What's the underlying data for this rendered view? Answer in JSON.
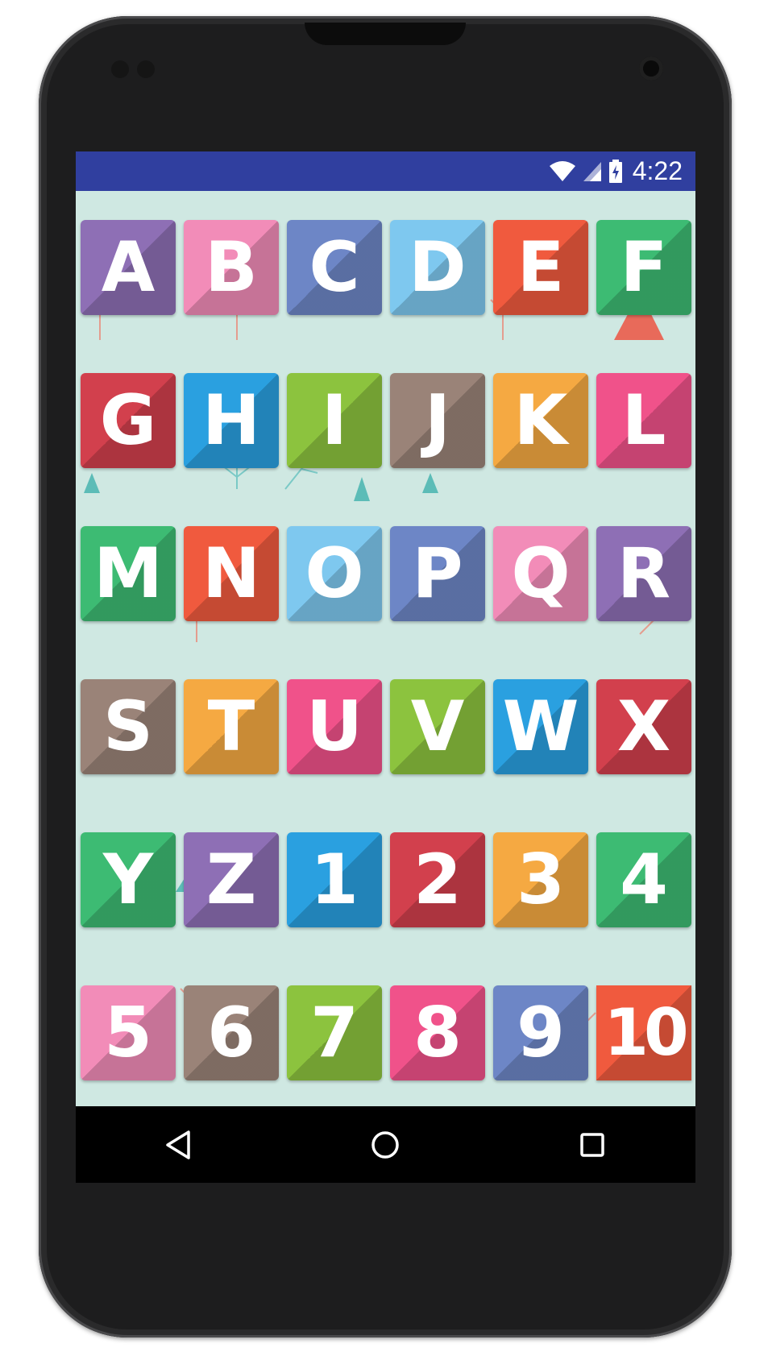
{
  "status_bar": {
    "time": "4:22",
    "icons": [
      "wifi-icon",
      "cell-signal-icon",
      "battery-charging-icon"
    ],
    "color": "#303f9f"
  },
  "tiles": [
    {
      "label": "A",
      "color": "#8e6fb5"
    },
    {
      "label": "B",
      "color": "#f28cb8"
    },
    {
      "label": "C",
      "color": "#6d86c6"
    },
    {
      "label": "D",
      "color": "#7ec8ef"
    },
    {
      "label": "E",
      "color": "#f05a3e"
    },
    {
      "label": "F",
      "color": "#3dbb73"
    },
    {
      "label": "G",
      "color": "#d2404d"
    },
    {
      "label": "H",
      "color": "#2aa0e0"
    },
    {
      "label": "I",
      "color": "#8cc33e"
    },
    {
      "label": "J",
      "color": "#9a8378"
    },
    {
      "label": "K",
      "color": "#f5a942"
    },
    {
      "label": "L",
      "color": "#f0528a"
    },
    {
      "label": "M",
      "color": "#3dbb73"
    },
    {
      "label": "N",
      "color": "#f05a3e"
    },
    {
      "label": "O",
      "color": "#7ec8ef"
    },
    {
      "label": "P",
      "color": "#6d86c6"
    },
    {
      "label": "Q",
      "color": "#f28cb8"
    },
    {
      "label": "R",
      "color": "#8e6fb5"
    },
    {
      "label": "S",
      "color": "#9a8378"
    },
    {
      "label": "T",
      "color": "#f5a942"
    },
    {
      "label": "U",
      "color": "#f0528a"
    },
    {
      "label": "V",
      "color": "#8cc33e"
    },
    {
      "label": "W",
      "color": "#2aa0e0"
    },
    {
      "label": "X",
      "color": "#d2404d"
    },
    {
      "label": "Y",
      "color": "#3dbb73"
    },
    {
      "label": "Z",
      "color": "#8e6fb5"
    },
    {
      "label": "1",
      "color": "#2aa0e0"
    },
    {
      "label": "2",
      "color": "#d2404d"
    },
    {
      "label": "3",
      "color": "#f5a942"
    },
    {
      "label": "4",
      "color": "#3dbb73"
    },
    {
      "label": "5",
      "color": "#f28cb8"
    },
    {
      "label": "6",
      "color": "#9a8378"
    },
    {
      "label": "7",
      "color": "#8cc33e"
    },
    {
      "label": "8",
      "color": "#f0528a"
    },
    {
      "label": "9",
      "color": "#6d86c6"
    },
    {
      "label": "10",
      "color": "#f05a3e"
    }
  ],
  "nav_bar": {
    "buttons": [
      "back-icon",
      "home-icon",
      "recents-icon"
    ]
  }
}
